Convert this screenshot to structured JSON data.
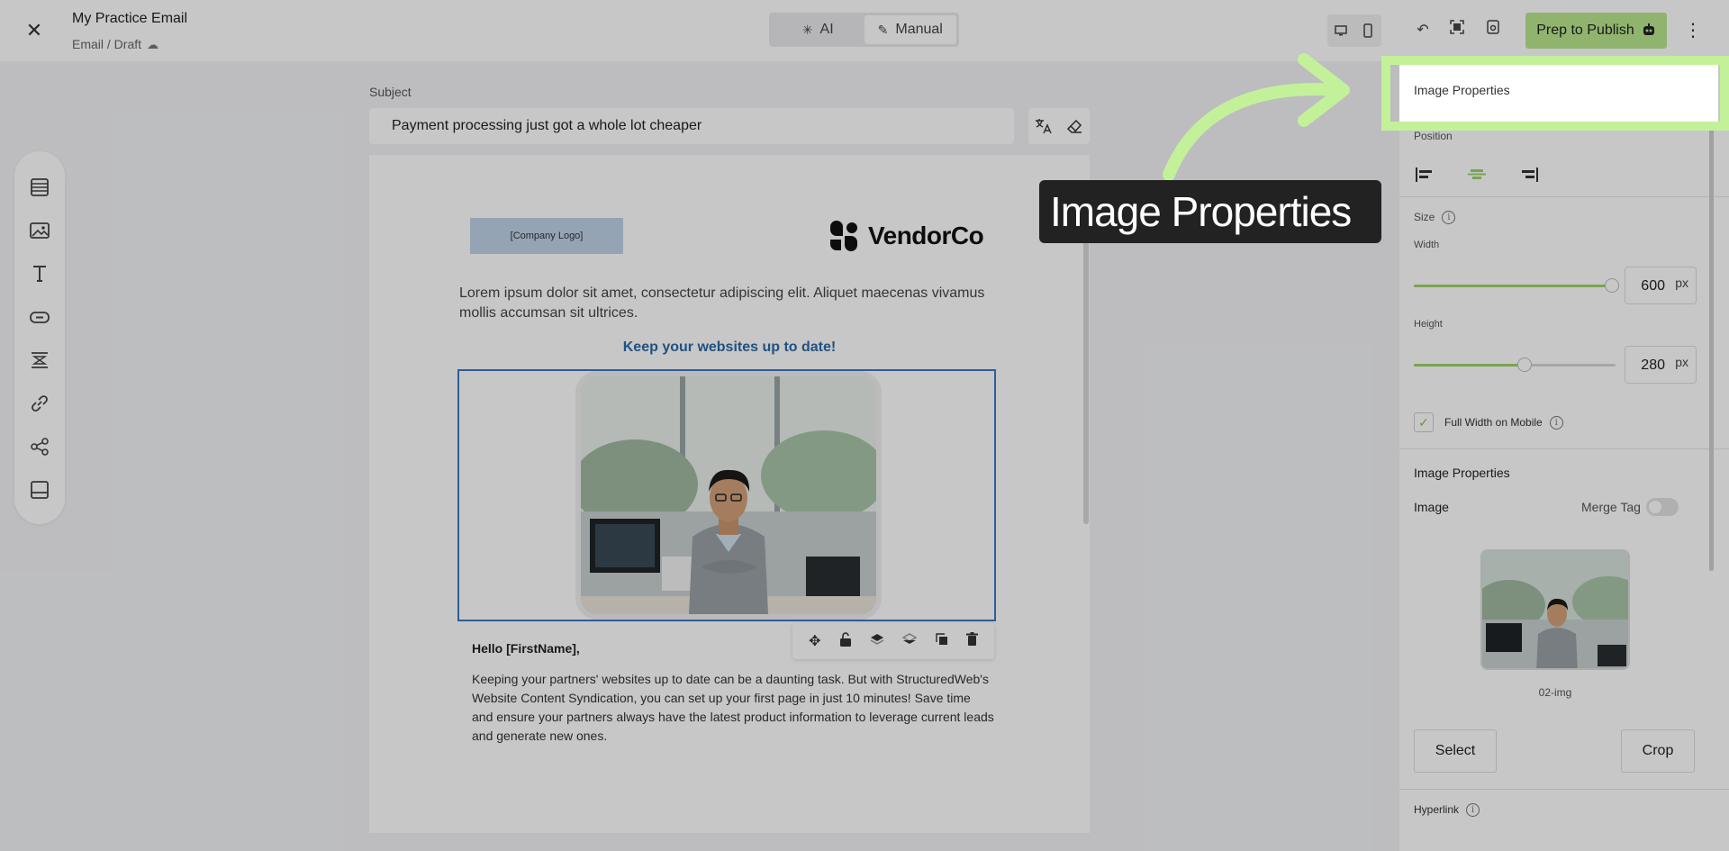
{
  "header": {
    "title": "My Practice Email",
    "path": "Email / Draft",
    "close_icon": "close-icon",
    "modes": [
      {
        "label": "AI",
        "icon": "sparkle-icon"
      },
      {
        "label": "Manual",
        "icon": "pencil-icon"
      }
    ],
    "publish_label": "Prep to Publish"
  },
  "toolbox": [
    "rows-icon",
    "image-icon",
    "text-icon",
    "button-icon",
    "spacer-icon",
    "link-icon",
    "share-icon",
    "footer-icon"
  ],
  "editor": {
    "subject_label": "Subject",
    "subject_value": "Payment processing just got a whole lot cheaper",
    "logo_placeholder": "[Company Logo]",
    "brand_name": "VendorCo",
    "lorem": "Lorem ipsum dolor sit amet, consectetur adipiscing elit. Aliquet maecenas vivamus mollis accumsan sit ultrices.",
    "headline": "Keep your websites up to date!",
    "greeting": "Hello [FirstName],",
    "body": "Keeping your partners' websites up to date can be a daunting task. But with StructuredWeb's Website Content Syndication, you can set up your first page in just 10 minutes! Save time and ensure your partners always have the latest product information to leverage current leads and generate new ones."
  },
  "panel": {
    "title": "Image Properties",
    "position_label": "Position",
    "size_label": "Size",
    "width_label": "Width",
    "width_value": "600",
    "width_unit": "px",
    "width_fraction": 0.98,
    "height_label": "Height",
    "height_value": "280",
    "height_unit": "px",
    "height_fraction": 0.55,
    "full_width_label": "Full Width on Mobile",
    "section_title": "Image Properties",
    "image_label": "Image",
    "merge_tag_label": "Merge Tag",
    "thumb_caption": "02-img",
    "select_label": "Select",
    "crop_label": "Crop",
    "hyperlink_label": "Hyperlink"
  },
  "tooltip": {
    "text": "Image Properties"
  },
  "colors": {
    "accent_green": "#b9e78e",
    "highlight_green": "#c3f19a",
    "link_blue": "#2b6aa6",
    "selection_blue": "#3c78c3"
  }
}
